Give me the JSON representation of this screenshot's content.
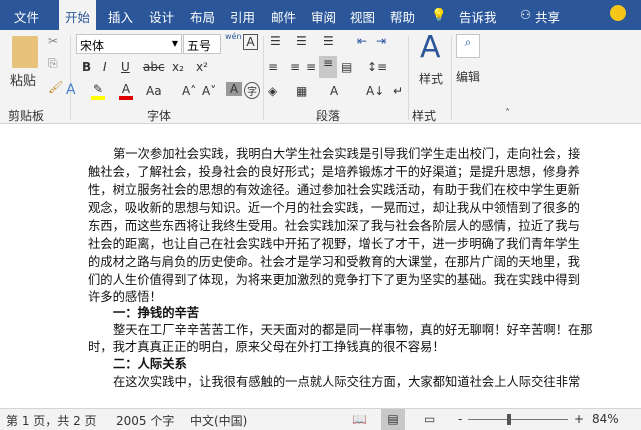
{
  "tabs": [
    "文件",
    "开始",
    "插入",
    "设计",
    "布局",
    "引用",
    "邮件",
    "审阅",
    "视图",
    "帮助",
    "告诉我",
    "共享"
  ],
  "ribbon": {
    "paste": "粘贴",
    "font_name": "宋体",
    "font_size": "五号",
    "groups": [
      "剪贴板",
      "字体",
      "段落",
      "样式",
      "编辑"
    ],
    "styles_btn": "样式",
    "edit_btn": "编辑",
    "bold": "B",
    "italic": "I",
    "underline": "U",
    "strike": "abc",
    "sub": "x₂",
    "sup": "x²",
    "case": "Aa",
    "pinyin": "wén"
  },
  "doc": {
    "p1": [
      "第一次参加社会实践，我明白大学生社会实践是引导我们学生走出校门，走向社会，接",
      "触社会，了解社会，投身社会的良好形式；是培养锻炼才干的好渠道；是提升思想，修身养",
      "性，树立服务社会的思想的有效途径。通过参加社会实践活动，有助于我们在校中学生更新",
      "观念，吸收新的思想与知识。近一个月的社会实践，一晃而过，却让我从中领悟到了很多的",
      "东西，而这些东西将让我终生受用。社会实践加深了我与社会各阶层人的感情，拉近了我与",
      "社会的距离，也让自己在社会实践中开拓了视野，增长了才干，进一步明确了我们青年学生",
      "的成材之路与肩负的历史使命。社会才是学习和受教育的大课堂，在那片广阔的天地里，我",
      "们的人生价值得到了体现，为将来更加激烈的竞争打下了更为坚实的基础。我在实践中得到",
      "许多的感悟！"
    ],
    "h1": "一：挣钱的辛苦",
    "p2": [
      "整天在工厂辛辛苦苦工作，天天面对的都是同一样事物，真的好无聊啊！好辛苦啊！在那",
      "时，我才真真正正的明白，原来父母在外打工挣钱真的很不容易！"
    ],
    "h2": "二：人际关系",
    "p3": [
      "在这次实践中，让我很有感触的一点就人际交往方面，大家都知道社会上人际交往非常"
    ]
  },
  "status": {
    "page": "第 1 页，共 2 页",
    "words": "2005 个字",
    "lang": "中文(中国)",
    "zoom": "84%",
    "zoom_percent": 84
  },
  "colors": {
    "tabbar": "#2b579a",
    "highlight": "#ffff00",
    "font_color": "#e00000"
  }
}
